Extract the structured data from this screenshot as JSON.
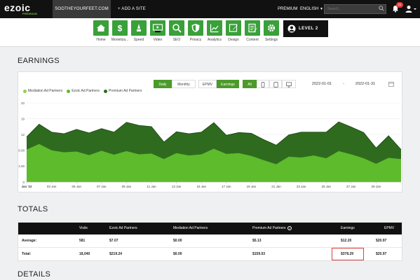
{
  "topbar": {
    "logo": "ezoic",
    "logo_sub": "PREMIUM",
    "site_name": "SOOTHEYOURFEET.COM",
    "add_site": "+ ADD A SITE",
    "premium": "PREMIUM",
    "language": "ENGLISH",
    "search_placeholder": "Search...",
    "notification_count": "21"
  },
  "nav": {
    "items": [
      {
        "label": "Home",
        "icon": "home-icon"
      },
      {
        "label": "Monetiza...",
        "icon": "dollar-icon"
      },
      {
        "label": "Speed",
        "icon": "speed-icon"
      },
      {
        "label": "Video",
        "icon": "video-icon"
      },
      {
        "label": "SEO",
        "icon": "magnifier-icon"
      },
      {
        "label": "Privacy",
        "icon": "shield-icon"
      },
      {
        "label": "Analytics",
        "icon": "analytics-icon"
      },
      {
        "label": "Design",
        "icon": "design-icon"
      },
      {
        "label": "Content",
        "icon": "content-icon"
      },
      {
        "label": "Settings",
        "icon": "gear-icon"
      }
    ],
    "level_label": "LEVEL 2"
  },
  "earnings": {
    "title": "EARNINGS",
    "buttons": {
      "daily": "Daily",
      "monthly": "Monthly",
      "epmv": "EPMV",
      "earnings": "Earnings",
      "all": "All"
    },
    "date_from": "2022-01-01",
    "date_sep": "-",
    "date_to": "2022-01-31"
  },
  "totals": {
    "title": "TOTALS",
    "columns": [
      "Visits",
      "Ezoic Ad Partners",
      "Mediation Ad Partners",
      "Premium Ad Partners",
      "Earnings",
      "EPMV"
    ],
    "rows": [
      {
        "label": "Average:",
        "values": [
          "581",
          "$7.07",
          "$0.00",
          "$5.13",
          "$12.20",
          "$20.97"
        ]
      },
      {
        "label": "Total:",
        "values": [
          "18,040",
          "$219.24",
          "$0.00",
          "$159.03",
          "$378.29",
          "$20.97"
        ]
      }
    ]
  },
  "details": {
    "title": "DETAILS"
  },
  "colors": {
    "accent": "#4c9a2a",
    "mediation": "#8fd14f",
    "ezoic": "#5dbb2c",
    "premium": "#2f6b1f"
  },
  "chart_data": {
    "type": "area",
    "legend": [
      "Mediation Ad Partners",
      "Ezoic Ad Partners",
      "Premium Ad Partners"
    ],
    "x": [
      "Jan '22",
      "02 Jan",
      "03 Jan",
      "04 Jan",
      "05 Jan",
      "06 Jan",
      "07 Jan",
      "08 Jan",
      "09 Jan",
      "10 Jan",
      "11 Jan",
      "12 Jan",
      "13 Jan",
      "14 Jan",
      "15 Jan",
      "16 Jan",
      "17 Jan",
      "18 Jan",
      "19 Jan",
      "20 Jan",
      "21 Jan",
      "22 Jan",
      "23 Jan",
      "24 Jan",
      "25 Jan",
      "26 Jan",
      "27 Jan",
      "28 Jan",
      "29 Jan",
      "30 Jan",
      "31 Jan"
    ],
    "xticks": [
      "Jan '22",
      "03 Jan",
      "05 Jan",
      "07 Jan",
      "09 Jan",
      "11 Jan",
      "13 Jan",
      "15 Jan",
      "17 Jan",
      "19 Jan",
      "21 Jan",
      "23 Jan",
      "25 Jan",
      "27 Jan",
      "29 Jan"
    ],
    "yticks": [
      "0",
      "4.00",
      "8.00",
      "12",
      "16",
      "20"
    ],
    "ylim": [
      0,
      20
    ],
    "series": [
      {
        "name": "Mediation Ad Partners",
        "values": [
          0,
          0,
          0,
          0,
          0,
          0,
          0,
          0,
          0,
          0,
          0,
          0,
          0,
          0,
          0,
          0,
          0,
          0,
          0,
          0,
          0,
          0,
          0,
          0,
          0,
          0,
          0,
          0,
          0,
          0,
          0
        ]
      },
      {
        "name": "Ezoic Ad Partners",
        "values": [
          8.2,
          9.6,
          8.0,
          7.5,
          7.7,
          6.8,
          7.9,
          6.9,
          7.8,
          7.0,
          7.2,
          5.8,
          7.3,
          6.7,
          7.0,
          8.4,
          7.1,
          7.3,
          6.6,
          5.5,
          4.5,
          6.4,
          6.2,
          6.7,
          6.0,
          7.8,
          7.0,
          6.0,
          4.6,
          6.1,
          5.8
        ]
      },
      {
        "name": "Premium Ad Partners",
        "values": [
          3.2,
          5.0,
          4.6,
          4.7,
          5.6,
          5.6,
          5.6,
          5.7,
          7.3,
          7.3,
          6.8,
          4.3,
          5.4,
          5.5,
          5.6,
          6.6,
          4.7,
          5.2,
          5.7,
          5.2,
          4.8,
          5.5,
          6.4,
          5.9,
          6.6,
          7.4,
          6.9,
          6.5,
          4.0,
          5.6,
          2.4
        ]
      }
    ]
  }
}
